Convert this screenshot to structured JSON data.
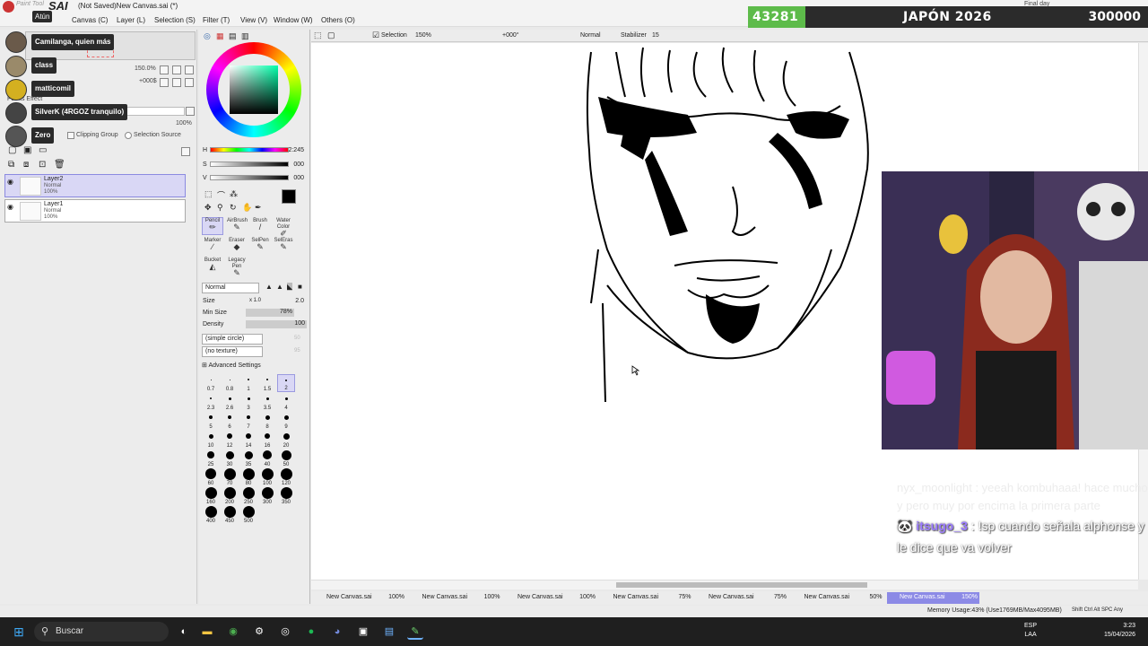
{
  "title": {
    "app": "Paint Tool",
    "sai": "SAI",
    "document": "(Not Saved)New Canvas.sai (*)"
  },
  "menu": [
    "Atún",
    "Canvas (C)",
    "Layer (L)",
    "Selection (S)",
    "Filter (T)",
    "View (V)",
    "Window (W)",
    "Others (O)"
  ],
  "goal": {
    "current": "43281",
    "title": "JAPÓN 2026",
    "target": "300000",
    "subtitle": "Final day",
    "progress": 0.144
  },
  "left_panel": {
    "zoom": "150.0%",
    "angle": "+000$",
    "opacity": "100%",
    "blending": "Blending",
    "paints_effect": "Paints Effect",
    "protect": "Protect Opacity",
    "clipping": "Clipping Group",
    "selection_source": "Selection Source",
    "layers": [
      {
        "name": "Layer2",
        "mode": "Normal",
        "opacity": "100%",
        "selected": true
      },
      {
        "name": "Layer1",
        "mode": "Normal",
        "opacity": "100%",
        "selected": false
      }
    ]
  },
  "chat_overlay": [
    "Atún",
    "Camilanga, quien más",
    "class",
    "matticomil",
    "SilverK (4RGOZ tranquilo)",
    "Zero"
  ],
  "color": {
    "h": "2:245",
    "s": "000",
    "v": "000",
    "h_label": "H",
    "s_label": "S",
    "v_label": "V"
  },
  "tools": [
    {
      "label": "Pencil",
      "icon": "✏"
    },
    {
      "label": "AirBrush",
      "icon": "✎"
    },
    {
      "label": "Brush",
      "icon": "/"
    },
    {
      "label": "Water Color",
      "icon": "✐"
    },
    {
      "label": "Marker",
      "icon": "∕"
    },
    {
      "label": "Eraser",
      "icon": "◆"
    },
    {
      "label": "SelPen",
      "icon": "✎"
    },
    {
      "label": "SelEras",
      "icon": "✎"
    },
    {
      "label": "Bucket",
      "icon": "◭"
    },
    {
      "label": "Legacy Pen",
      "icon": "✎"
    }
  ],
  "brush": {
    "blend_mode": "Normal",
    "size_label": "Size",
    "size_mult": "x 1.0",
    "size_value": "2.0",
    "min_size_label": "Min Size",
    "min_size": "78%",
    "density_label": "Density",
    "density": "100",
    "shape": "(simple circle)",
    "shape_val": "50",
    "texture": "(no texture)",
    "texture_val": "95",
    "advanced": "Advanced Settings"
  },
  "brush_sizes": [
    "0.7",
    "0.8",
    "1",
    "1.5",
    "2",
    "2.3",
    "2.6",
    "3",
    "3.5",
    "4",
    "5",
    "6",
    "7",
    "8",
    "9",
    "10",
    "12",
    "14",
    "16",
    "20",
    "25",
    "30",
    "35",
    "40",
    "50",
    "60",
    "70",
    "80",
    "100",
    "120",
    "160",
    "200",
    "250",
    "300",
    "350",
    "400",
    "450",
    "500"
  ],
  "canvas_toolbar": {
    "selection": "Selection",
    "zoom": "150%",
    "angle": "+000°",
    "mode": "Normal",
    "stabilizer_label": "Stabilizer",
    "stabilizer": "15"
  },
  "tabs": [
    {
      "name": "New Canvas.sai",
      "zoom": "100%"
    },
    {
      "name": "New Canvas.sai",
      "zoom": "100%"
    },
    {
      "name": "New Canvas.sai",
      "zoom": "100%"
    },
    {
      "name": "New Canvas.sai",
      "zoom": "75%"
    },
    {
      "name": "New Canvas.sai",
      "zoom": "75%"
    },
    {
      "name": "New Canvas.sai",
      "zoom": "50%"
    },
    {
      "name": "New Canvas.sai",
      "zoom": "150%"
    }
  ],
  "status": {
    "memory": "Memory Usage:43% (Use1769MB/Max4095MB)",
    "keys": "Shift Ctrl Alt SPC Any"
  },
  "chat": {
    "faded": "nyx_moonlight : yeeah kombuhaaa! hace mucho y pero muy por encima la primera parte",
    "user": "itsugo_3",
    "message": ": !sp cuando señala alphonse y le dice que va volver"
  },
  "taskbar": {
    "search": "Buscar",
    "lang_top": "ESP",
    "lang_bottom": "LAA",
    "time": "3:23",
    "date": "15/04/2026"
  }
}
